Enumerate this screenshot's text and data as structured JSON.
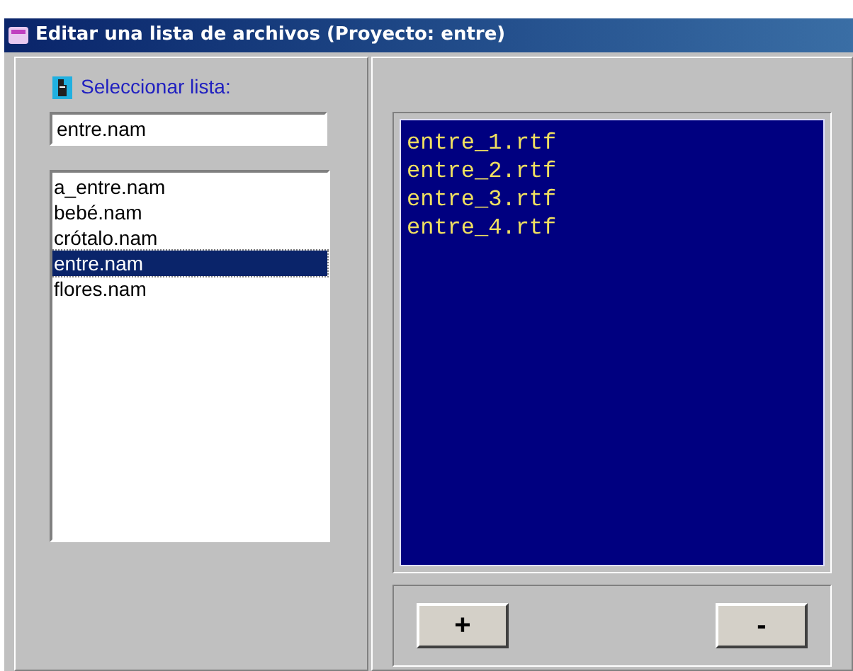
{
  "window": {
    "title": "Editar una lista de archivos (Proyecto: entre)"
  },
  "select_label": "Seleccionar lista:",
  "list_field": {
    "value": "entre.nam"
  },
  "lists": [
    {
      "label": "a_entre.nam",
      "selected": false
    },
    {
      "label": "bebé.nam",
      "selected": false
    },
    {
      "label": "crótalo.nam",
      "selected": false
    },
    {
      "label": "entre.nam",
      "selected": true
    },
    {
      "label": "flores.nam",
      "selected": false
    }
  ],
  "files": [
    "entre_1.rtf",
    "entre_2.rtf",
    "entre_3.rtf",
    "entre_4.rtf"
  ],
  "buttons": [
    "+",
    "-"
  ]
}
